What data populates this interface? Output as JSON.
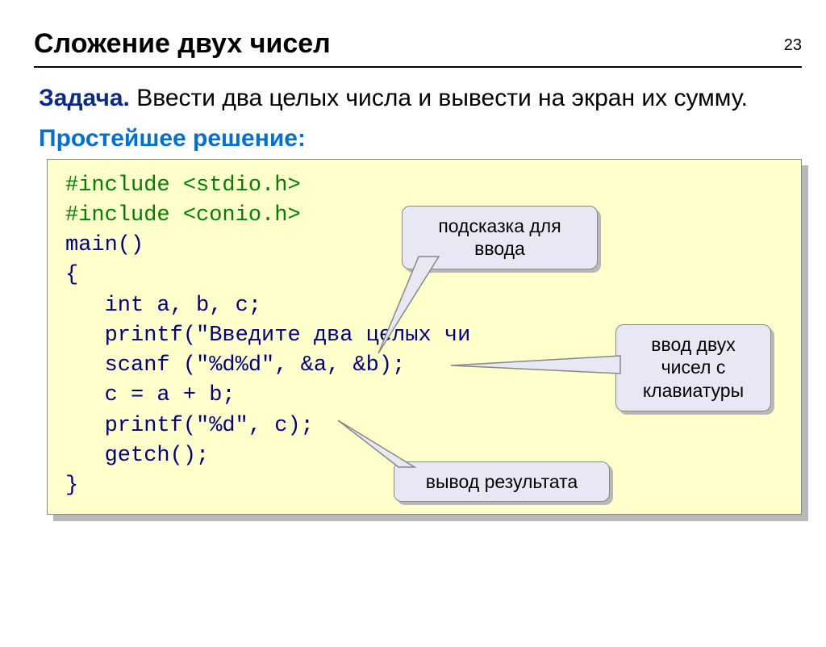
{
  "page_number": "23",
  "title": "Сложение двух чисел",
  "task_label": "Задача.",
  "task_text": " Ввести два целых числа и вывести на экран их сумму.",
  "solution_label": "Простейшее решение:",
  "code": {
    "l1": "#include <stdio.h>",
    "l2": "#include <conio.h>",
    "l3": "main()",
    "l4": "{",
    "l5": "   int a, b, c;",
    "l6": "   printf(\"Введите два целых чи",
    "l7": "   scanf (\"%d%d\", &a, &b);",
    "l8": "   c = a + b;",
    "l9": "   printf(\"%d\", c);",
    "l10": "   getch();",
    "l11": "}"
  },
  "callouts": {
    "hint": "подсказка для ввода",
    "input": "ввод двух чисел с клавиатуры",
    "output": "вывод результата"
  }
}
